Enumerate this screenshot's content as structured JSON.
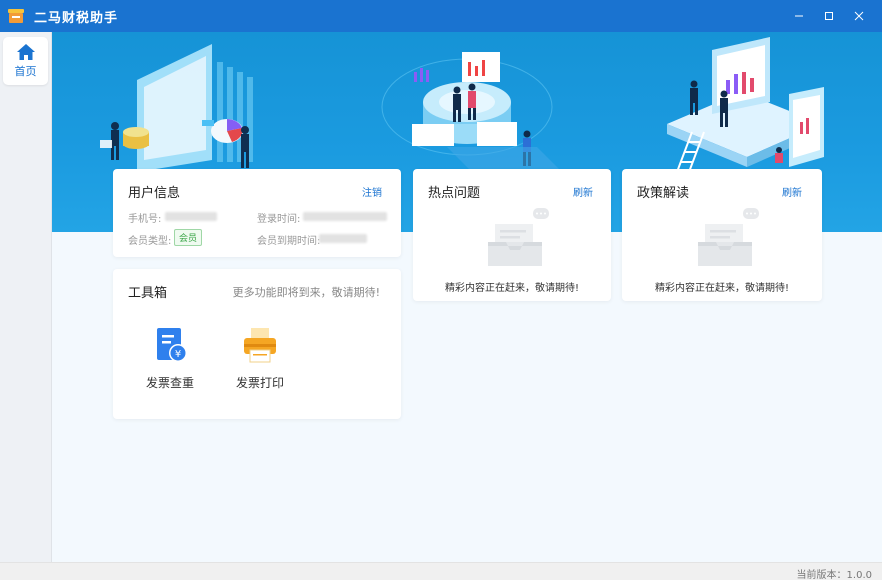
{
  "app": {
    "title": "二马财税助手"
  },
  "sidebar": {
    "items": [
      {
        "label": "首页",
        "icon": "home-icon"
      }
    ]
  },
  "user_info": {
    "title": "用户信息",
    "logout": "注销",
    "phone_label": "手机号:",
    "login_time_label": "登录时间:",
    "member_type_label": "会员类型:",
    "member_type_value": "会员",
    "member_expiry_label": "会员到期时间:"
  },
  "toolbox": {
    "title": "工具箱",
    "subtitle": "更多功能即将到来，敬请期待!",
    "tools": [
      {
        "label": "发票查重",
        "icon": "invoice-check-icon"
      },
      {
        "label": "发票打印",
        "icon": "printer-icon"
      }
    ]
  },
  "hot_issues": {
    "title": "热点问题",
    "refresh": "刷新",
    "empty": "精彩内容正在赶来，敬请期待!"
  },
  "policy": {
    "title": "政策解读",
    "refresh": "刷新",
    "empty": "精彩内容正在赶来，敬请期待!"
  },
  "status": {
    "version": "当前版本：1.0.0"
  },
  "colors": {
    "brand": "#1a73d0",
    "banner": "#1693d6",
    "accent_orange": "#f5a623"
  }
}
